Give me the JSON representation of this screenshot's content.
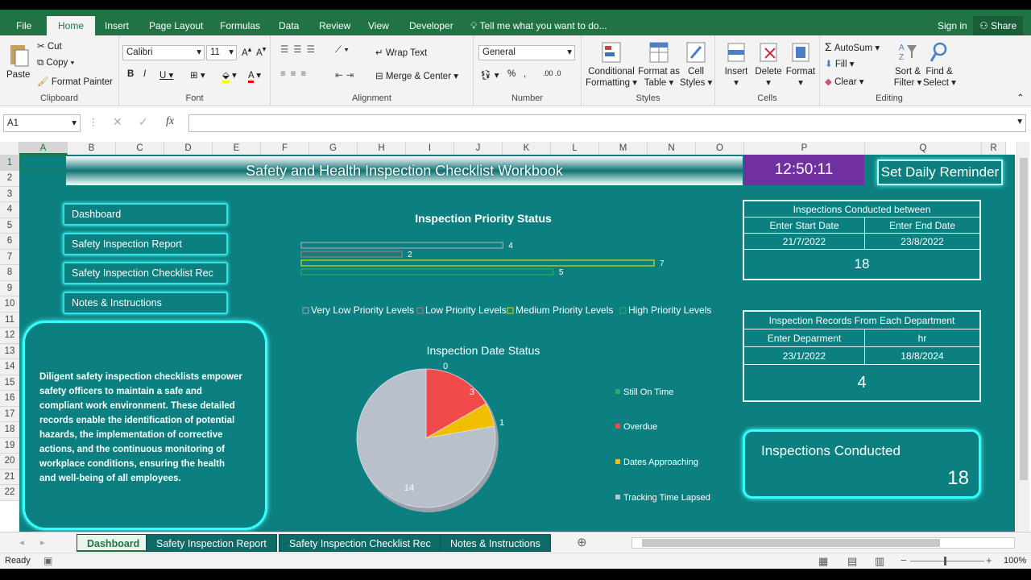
{
  "ribbon_tabs": [
    "File",
    "Home",
    "Insert",
    "Page Layout",
    "Formulas",
    "Data",
    "Review",
    "View",
    "Developer"
  ],
  "tell_me": "Tell me what you want to do...",
  "sign_in": "Sign in",
  "share": "Share",
  "clipboard": {
    "paste": "Paste",
    "cut": "Cut",
    "copy": "Copy",
    "format_painter": "Format Painter",
    "label": "Clipboard"
  },
  "font": {
    "name": "Calibri",
    "size": "11",
    "label": "Font"
  },
  "alignment": {
    "wrap": "Wrap Text",
    "merge": "Merge & Center",
    "label": "Alignment"
  },
  "number": {
    "format": "General",
    "label": "Number"
  },
  "styles": {
    "conditional": "Conditional",
    "formatting": "Formatting",
    "format_as": "Format as",
    "table": "Table",
    "cell": "Cell",
    "styles": "Styles",
    "label": "Styles"
  },
  "cells": {
    "insert": "Insert",
    "delete": "Delete",
    "format": "Format",
    "label": "Cells"
  },
  "editing": {
    "autosum": "AutoSum",
    "fill": "Fill",
    "clear": "Clear",
    "sort": "Sort &",
    "filter": "Filter",
    "find": "Find &",
    "select": "Select",
    "label": "Editing"
  },
  "name_box": "A1",
  "fx": "fx",
  "columns": [
    "A",
    "B",
    "C",
    "D",
    "E",
    "F",
    "G",
    "H",
    "I",
    "J",
    "K",
    "L",
    "M",
    "N",
    "O",
    "P",
    "Q",
    "R"
  ],
  "rows": [
    "1",
    "2",
    "3",
    "4",
    "5",
    "6",
    "7",
    "8",
    "9",
    "10",
    "11",
    "12",
    "13",
    "14",
    "15",
    "16",
    "17",
    "18",
    "19",
    "20",
    "21",
    "22"
  ],
  "dashboard": {
    "title": "Safety and Health Inspection Checklist Workbook",
    "clock": "12:50:11",
    "reminder": "Set Daily Reminder",
    "nav": [
      "Dashboard",
      "Safety Inspection Report",
      "Safety Inspection Checklist Rec",
      "Notes & Instructions"
    ],
    "description": "Diligent safety inspection checklists empower safety officers to maintain a safe and compliant work environment. These detailed records enable the identification of potential hazards, the implementation of corrective actions, and the continuous monitoring of workplace conditions, ensuring the health and well-being of all employees.",
    "between": {
      "title": "Inspections Conducted between",
      "start_label": "Enter Start Date",
      "end_label": "Enter End Date",
      "start": "21/7/2022",
      "end": "23/8/2022",
      "count": "18"
    },
    "dept": {
      "title": "Inspection Records From Each Department",
      "dept_label": "Enter Deparment",
      "dept_value": "hr",
      "start": "23/1/2022",
      "end": "18/8/2024",
      "count": "4"
    },
    "conducted": {
      "label": "Inspections Conducted",
      "value": "18"
    }
  },
  "chart_data": [
    {
      "type": "bar",
      "title": "Inspection Priority Status",
      "categories": [
        "Very Low Priority Levels",
        "Low Priority Levels",
        "Medium Priority Levels",
        "High Priority Levels"
      ],
      "values": [
        4,
        2,
        7,
        5
      ],
      "colors": [
        "#9aa8b4",
        "#b07a70",
        "#d8d800",
        "#22b060"
      ],
      "legend": "bottom",
      "xlim": [
        0,
        7
      ]
    },
    {
      "type": "pie",
      "title": "Inspection Date Status",
      "categories": [
        "Still On Time",
        "Overdue",
        "Dates Approaching",
        "Tracking Time Lapsed"
      ],
      "values": [
        0,
        3,
        1,
        14
      ],
      "colors": [
        "#22b060",
        "#f04a4a",
        "#f0c000",
        "#b8c0cc"
      ],
      "legend": "right"
    }
  ],
  "sheet_tabs": [
    "Dashboard",
    "Safety Inspection Report",
    "Safety Inspection Checklist Rec",
    "Notes & Instructions"
  ],
  "status": {
    "ready": "Ready",
    "zoom": "100%"
  }
}
